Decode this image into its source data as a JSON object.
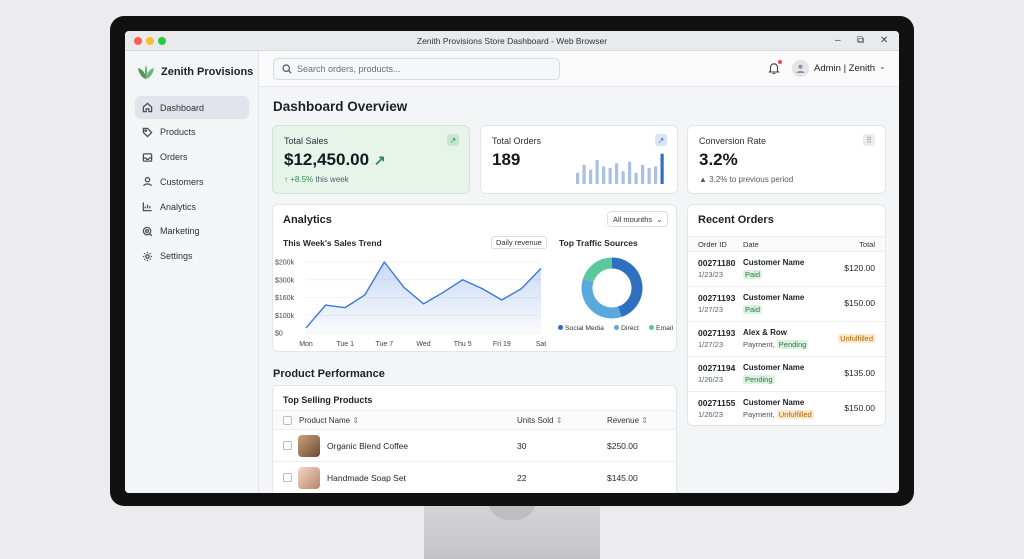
{
  "window": {
    "title": "Zenith Provisions Store Dashboard - Web Browser"
  },
  "brand": {
    "name": "Zenith Provisions",
    "accent": "#4a9b5c"
  },
  "sidebar": {
    "items": [
      {
        "label": "Dashboard",
        "icon": "home-icon",
        "active": true
      },
      {
        "label": "Products",
        "icon": "tag-icon"
      },
      {
        "label": "Orders",
        "icon": "inbox-icon"
      },
      {
        "label": "Customers",
        "icon": "user-icon"
      },
      {
        "label": "Analytics",
        "icon": "chart-icon"
      },
      {
        "label": "Marketing",
        "icon": "megaphone-icon"
      },
      {
        "label": "Settings",
        "icon": "gear-icon"
      }
    ]
  },
  "topbar": {
    "search_placeholder": "Search orders, products...",
    "user_label": "Admin | Zenith"
  },
  "main": {
    "title": "Dashboard Overview",
    "kpis": {
      "sales": {
        "label": "Total Sales",
        "value": "$12,450.00",
        "change": "↑ +8.5%",
        "change_suffix": " this week"
      },
      "orders": {
        "label": "Total Orders",
        "value": "189",
        "bars": [
          0.35,
          0.6,
          0.45,
          0.75,
          0.55,
          0.5,
          0.65,
          0.4,
          0.7,
          0.35,
          0.6,
          0.5,
          0.55,
          0.95
        ]
      },
      "conversion": {
        "label": "Conversion Rate",
        "value": "3.2%",
        "change": "▲ 3.2% to previous period"
      }
    },
    "analytics": {
      "title": "Analytics",
      "range": "All mounths",
      "trend_title": "This Week's Sales Trend",
      "trend_pill": "Daily revenue",
      "sources_title": "Top Traffic Sources"
    },
    "product_performance": {
      "title": "Product Performance",
      "subtitle": "Top Selling Products",
      "columns": [
        "Product Name",
        "Units Sold",
        "Revenue"
      ],
      "rows": [
        {
          "name": "Organic Blend Coffee",
          "units": "30",
          "revenue": "$250.00"
        },
        {
          "name": "Handmade Soap Set",
          "units": "22",
          "revenue": "$145.00"
        }
      ]
    },
    "recent_orders": {
      "title": "Recent Orders",
      "columns": [
        "Order ID",
        "Date",
        "Total"
      ],
      "rows": [
        {
          "id": "00271180",
          "date": "1/23/23",
          "customer": "Customer Name",
          "status": "Paid",
          "status_type": "paid",
          "total": "$120.00"
        },
        {
          "id": "00271193",
          "date": "1/27/23",
          "customer": "Customer Name",
          "status": "Paid",
          "status_type": "paid",
          "total": "$150.00"
        },
        {
          "id": "00271193",
          "date": "1/27/23",
          "customer": "Alex & Row",
          "status_prefix": "Payment, ",
          "status": "Pending",
          "status_type": "pend",
          "total": "Unfulfilled",
          "total_tag": true
        },
        {
          "id": "00271194",
          "date": "1/26/23",
          "customer": "Customer Name",
          "status": "Pending",
          "status_type": "pend",
          "total": "$135.00"
        },
        {
          "id": "00271155",
          "date": "1/26/23",
          "customer": "Customer Name",
          "status_prefix": "Payment, ",
          "status": "Unfulfilled",
          "status_type": "unf",
          "total": "$150.00"
        }
      ]
    }
  },
  "chart_data": [
    {
      "type": "area",
      "title": "This Week's Sales Trend",
      "categories": [
        "Mon",
        "Tue 1",
        "Tue 7",
        "Wed",
        "Thu 5",
        "Fri 19",
        "Sat"
      ],
      "x": [
        0,
        0.5,
        1,
        1.5,
        2,
        2.5,
        3,
        3.5,
        4,
        4.5,
        5,
        5.5,
        6
      ],
      "values": [
        20000,
        110000,
        100000,
        150000,
        280000,
        180000,
        115000,
        160000,
        210000,
        175000,
        130000,
        175000,
        255000
      ],
      "ylim": [
        0,
        200000
      ],
      "yticks": [
        "$0",
        "$100k",
        "$160k",
        "$300k",
        "$200k"
      ],
      "grid": true,
      "color": "#3d78d8"
    },
    {
      "type": "pie",
      "title": "Top Traffic Sources",
      "labels": [
        "Social Media",
        "Direct",
        "Email"
      ],
      "values": [
        45,
        35,
        20
      ],
      "colors": [
        "#2f6fc0",
        "#5aa9dc",
        "#5cc79a"
      ],
      "legend": "bottom"
    }
  ]
}
